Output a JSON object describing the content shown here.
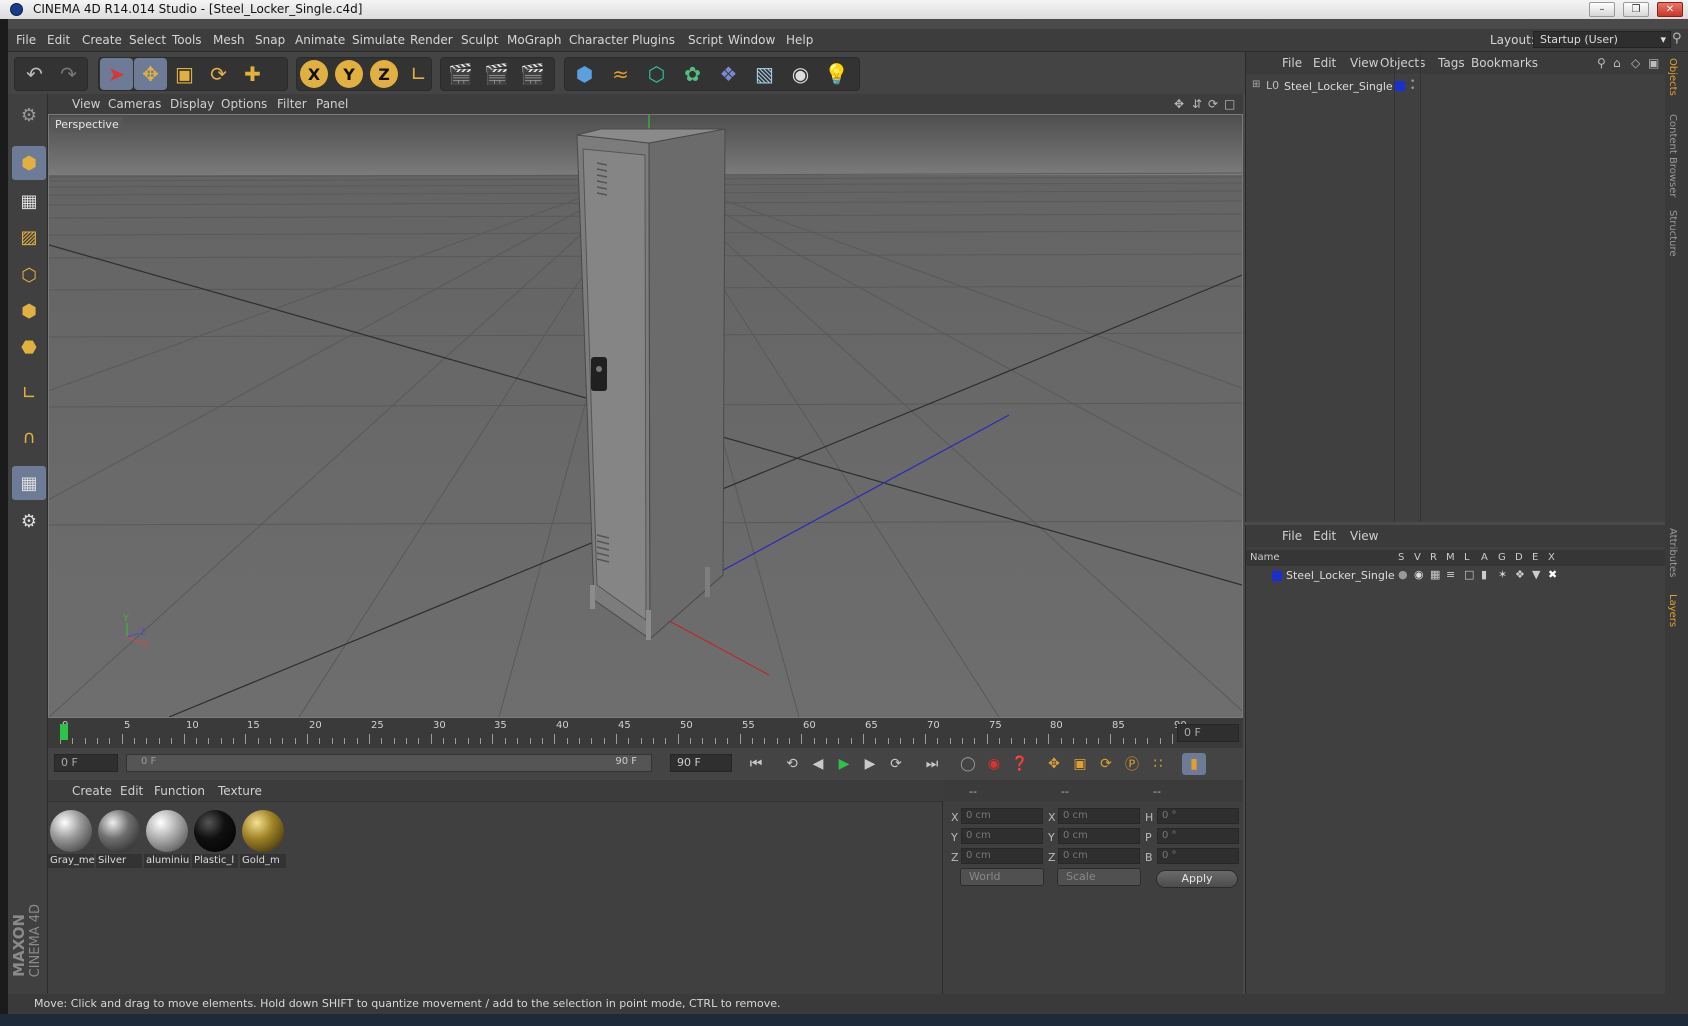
{
  "window": {
    "title": "CINEMA 4D R14.014 Studio - [Steel_Locker_Single.c4d]"
  },
  "menu": [
    "File",
    "Edit",
    "Create",
    "Select",
    "Tools",
    "Mesh",
    "Snap",
    "Animate",
    "Simulate",
    "Render",
    "Sculpt",
    "MoGraph",
    "Character",
    "Plugins",
    "Script",
    "Window",
    "Help"
  ],
  "layout": {
    "label": "Layout:",
    "value": "Startup (User)"
  },
  "viewport": {
    "menu": [
      "View",
      "Cameras",
      "Display",
      "Options",
      "Filter",
      "Panel"
    ],
    "label": "Perspective",
    "axis_labels": {
      "y": "Y",
      "x": "X",
      "z": "Z"
    }
  },
  "timeline": {
    "ticks": [
      "0",
      "5",
      "10",
      "15",
      "20",
      "25",
      "30",
      "35",
      "40",
      "45",
      "50",
      "55",
      "60",
      "65",
      "70",
      "75",
      "80",
      "85",
      "90"
    ],
    "current_frame": "0 F",
    "start_field": "0 F",
    "range_start": "0 F",
    "range_end": "90 F",
    "end_field": "90 F"
  },
  "materials": {
    "menu": [
      "Create",
      "Edit",
      "Function",
      "Texture"
    ],
    "items": [
      {
        "name": "Gray_me",
        "color": "#9a9a9a"
      },
      {
        "name": "Silver",
        "color": "#6f6f6f"
      },
      {
        "name": "aluminiu",
        "color": "#b0b0b0"
      },
      {
        "name": "Plastic_l",
        "color": "#101010"
      },
      {
        "name": "Gold_m",
        "color": "#a08428"
      }
    ]
  },
  "coordinates": {
    "header": [
      "--",
      "--",
      "--"
    ],
    "rows": [
      {
        "l1": "X",
        "v1": "0 cm",
        "l2": "X",
        "v2": "0 cm",
        "l3": "H",
        "v3": "0 °"
      },
      {
        "l1": "Y",
        "v1": "0 cm",
        "l2": "Y",
        "v2": "0 cm",
        "l3": "P",
        "v3": "0 °"
      },
      {
        "l1": "Z",
        "v1": "0 cm",
        "l2": "Z",
        "v2": "0 cm",
        "l3": "B",
        "v3": "0 °"
      }
    ],
    "mode": "World",
    "size_mode": "Scale",
    "apply": "Apply"
  },
  "objects": {
    "menu": [
      "File",
      "Edit",
      "View",
      "Objects",
      "Tags",
      "Bookmarks"
    ],
    "items": [
      {
        "name": "Steel_Locker_Single",
        "color": "#1a2fd0"
      }
    ]
  },
  "layers": {
    "menu": [
      "File",
      "Edit",
      "View"
    ],
    "columns": [
      "Name",
      "S",
      "V",
      "R",
      "M",
      "L",
      "A",
      "G",
      "D",
      "E",
      "X"
    ],
    "items": [
      {
        "name": "Steel_Locker_Single",
        "color": "#1a2fd0"
      }
    ]
  },
  "side_tabs": [
    "Objects",
    "Content Browser",
    "Structure",
    "Attributes",
    "Layers"
  ],
  "branding": {
    "line1": "MAXON",
    "line2": "CINEMA 4D"
  },
  "status": "Move: Click and drag to move elements. Hold down SHIFT to quantize movement / add to the selection in point mode, CTRL to remove."
}
